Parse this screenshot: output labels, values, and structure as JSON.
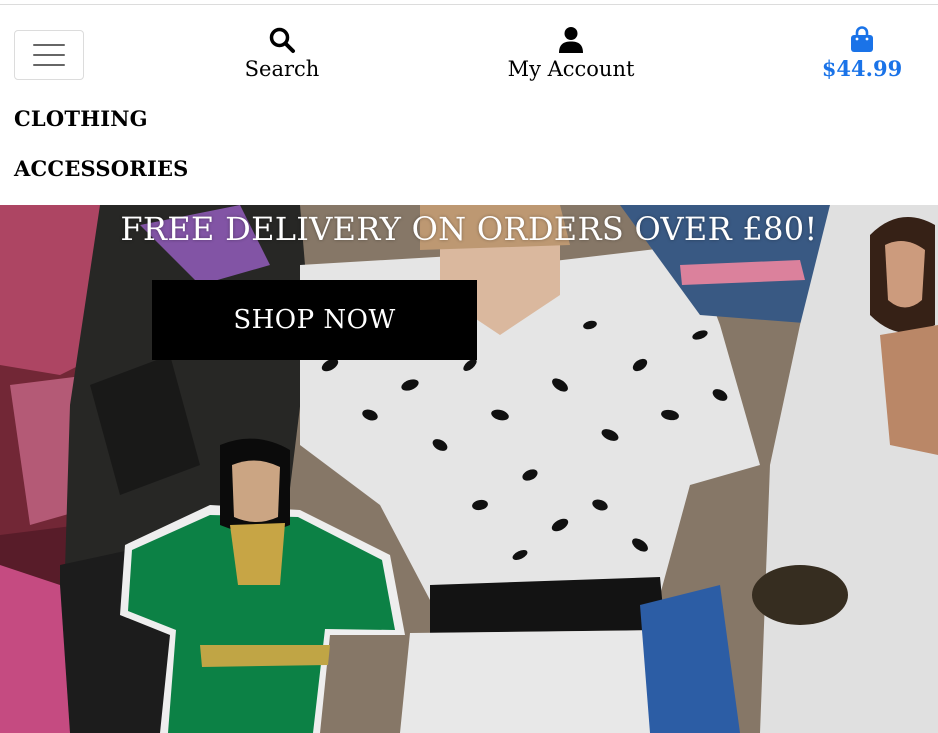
{
  "header": {
    "search_label": "Search",
    "account_label": "My Account",
    "cart_total": "$44.99",
    "icons": {
      "menu": "hamburger-icon",
      "search": "search-icon",
      "account": "user-icon",
      "cart": "shopping-bag-icon"
    },
    "accent_color": "#1a73e8"
  },
  "categories": [
    {
      "label": "CLOTHING"
    },
    {
      "label": "ACCESSORIES"
    }
  ],
  "hero": {
    "banner": "FREE DELIVERY ON ORDERS OVER £80!",
    "cta_label": "SHOP NOW"
  }
}
